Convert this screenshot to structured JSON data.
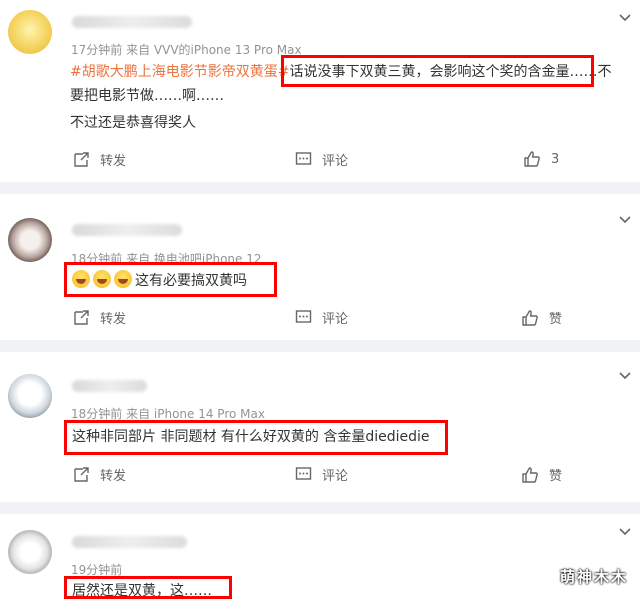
{
  "comments": [
    {
      "meta": "17分钟前  来自 VVV的iPhone 13 Pro Max",
      "tag": "#胡歌大鹏上海电影节影帝双黄蛋#",
      "line1_rest": "话说没事下双黄三黄，会影响这个奖的含金量……不",
      "line2": "要把电影节做……啊……",
      "line3": "不过还是恭喜得奖人",
      "repost_label": "转发",
      "comment_label": "评论",
      "like_label": "3"
    },
    {
      "meta": "18分钟前  来自 换电池吧iPhone 12",
      "body": "这有必要搞双黄吗",
      "repost_label": "转发",
      "comment_label": "评论",
      "like_label": "赞"
    },
    {
      "meta": "18分钟前  来自 iPhone 14 Pro Max",
      "body": "这种非同部片 非同题材 有什么好双黄的 含金量diediedie",
      "repost_label": "转发",
      "comment_label": "评论",
      "like_label": "赞"
    },
    {
      "meta": "19分钟前",
      "body": "居然还是双黄，这……"
    }
  ],
  "watermark": "萌神木木",
  "colors": {
    "topic_tag": "#eb7340",
    "highlight_box": "#ff0000",
    "separator": "#f1f2f5"
  }
}
